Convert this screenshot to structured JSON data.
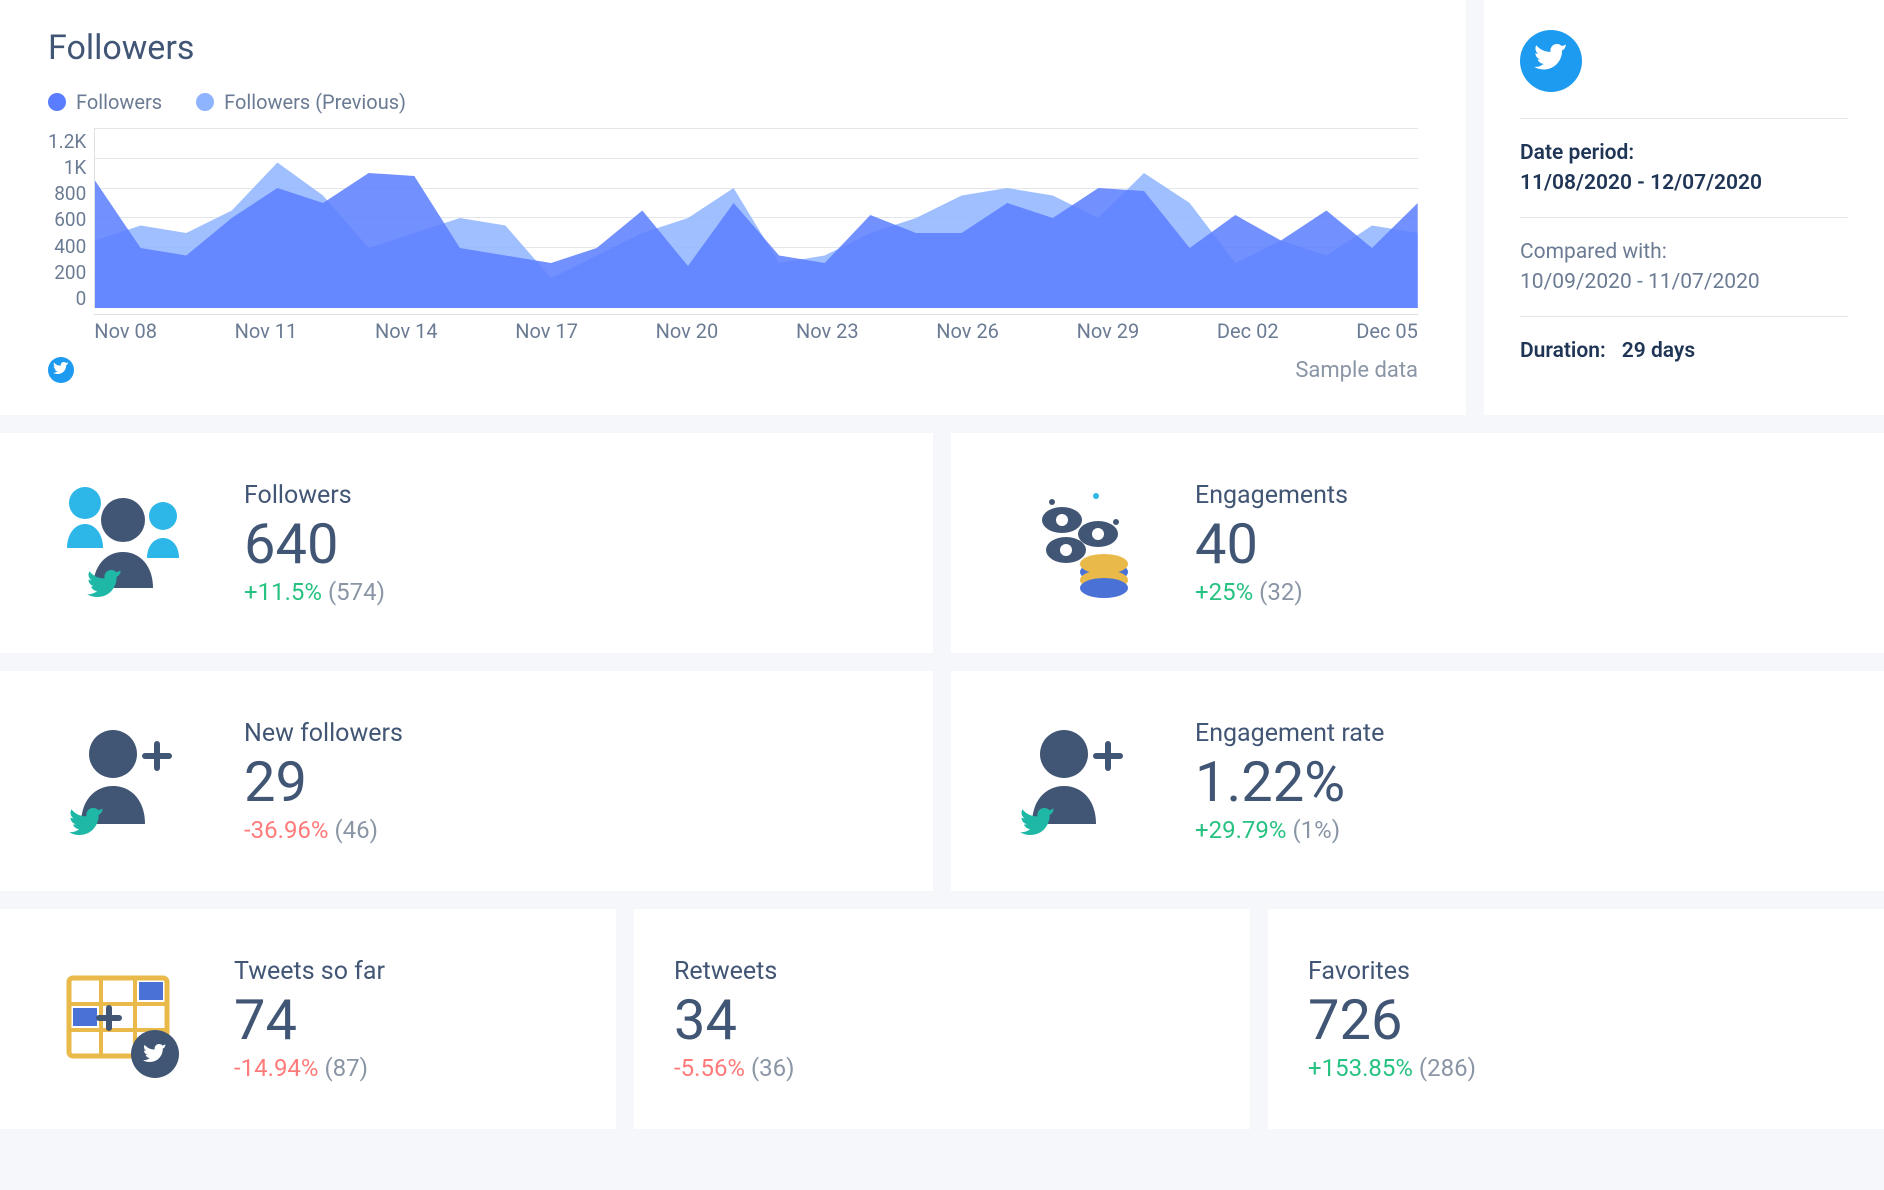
{
  "chart": {
    "title": "Followers",
    "legend": [
      {
        "label": "Followers",
        "color": "#5a7dff"
      },
      {
        "label": "Followers (Previous)",
        "color": "#8fb4ff"
      }
    ],
    "footer_badge": "twitter",
    "sample_label": "Sample data"
  },
  "chart_data": {
    "type": "area",
    "title": "Followers",
    "xlabel": "",
    "ylabel": "",
    "ylim": [
      0,
      1200
    ],
    "yticks": [
      "1.2K",
      "1K",
      "800",
      "600",
      "400",
      "200",
      "0"
    ],
    "categories": [
      "Nov 08",
      "Nov 11",
      "Nov 14",
      "Nov 17",
      "Nov 20",
      "Nov 23",
      "Nov 26",
      "Nov 29",
      "Dec 02",
      "Dec 05"
    ],
    "x": [
      "Nov 08",
      "Nov 09",
      "Nov 10",
      "Nov 11",
      "Nov 12",
      "Nov 13",
      "Nov 14",
      "Nov 15",
      "Nov 16",
      "Nov 17",
      "Nov 18",
      "Nov 19",
      "Nov 20",
      "Nov 21",
      "Nov 22",
      "Nov 23",
      "Nov 24",
      "Nov 25",
      "Nov 26",
      "Nov 27",
      "Nov 28",
      "Nov 29",
      "Nov 30",
      "Dec 01",
      "Dec 02",
      "Dec 03",
      "Dec 04",
      "Dec 05",
      "Dec 06",
      "Dec 07"
    ],
    "series": [
      {
        "name": "Followers",
        "color": "#5a7dff",
        "values": [
          850,
          400,
          350,
          600,
          800,
          700,
          900,
          880,
          400,
          350,
          300,
          400,
          650,
          280,
          700,
          350,
          300,
          620,
          500,
          500,
          700,
          600,
          800,
          780,
          400,
          620,
          450,
          650,
          400,
          700
        ]
      },
      {
        "name": "Followers (Previous)",
        "color": "#8fb4ff",
        "values": [
          450,
          550,
          500,
          650,
          970,
          750,
          400,
          500,
          600,
          550,
          200,
          350,
          500,
          600,
          800,
          300,
          350,
          500,
          600,
          750,
          800,
          750,
          600,
          900,
          700,
          300,
          450,
          350,
          550,
          500
        ]
      }
    ]
  },
  "side": {
    "date_period_label": "Date period:",
    "date_period_value": "11/08/2020 - 12/07/2020",
    "compared_label": "Compared with:",
    "compared_value": "10/09/2020 - 11/07/2020",
    "duration_label": "Duration:",
    "duration_value": "29 days"
  },
  "metrics": {
    "followers": {
      "label": "Followers",
      "value": "640",
      "change": "+11.5%",
      "prev": "(574)",
      "positive": true
    },
    "engagements": {
      "label": "Engagements",
      "value": "40",
      "change": "+25%",
      "prev": "(32)",
      "positive": true
    },
    "new_followers": {
      "label": "New followers",
      "value": "29",
      "change": "-36.96%",
      "prev": "(46)",
      "positive": false
    },
    "engagement_rate": {
      "label": "Engagement rate",
      "value": "1.22%",
      "change": "+29.79%",
      "prev": "(1%)",
      "positive": true
    },
    "tweets": {
      "label": "Tweets so far",
      "value": "74",
      "change": "-14.94%",
      "prev": "(87)",
      "positive": false
    },
    "retweets": {
      "label": "Retweets",
      "value": "34",
      "change": "-5.56%",
      "prev": "(36)",
      "positive": false
    },
    "favorites": {
      "label": "Favorites",
      "value": "726",
      "change": "+153.85%",
      "prev": "(286)",
      "positive": true
    }
  }
}
